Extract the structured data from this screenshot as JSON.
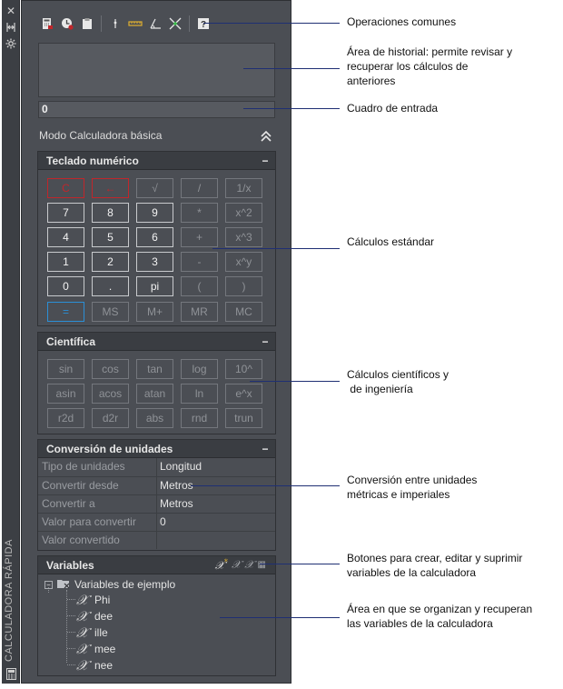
{
  "palette": {
    "panel_bg": "#4b4e54",
    "header_bg": "#3a3d42",
    "red_key": "#c0262b",
    "blue_key": "#2b8fd6",
    "callout_line": "#1f2f73"
  },
  "rail": {
    "icons": [
      "close-icon",
      "pin-icon",
      "settings-icon",
      "calculator-icon"
    ],
    "title": "CALCULADORA RÁPIDA"
  },
  "toolbar": {
    "icons": [
      "clear-icon",
      "history-clear-icon",
      "paste-icon",
      "get-point-icon",
      "distance-icon",
      "angle-icon",
      "intersection-icon",
      "help-icon"
    ]
  },
  "input": {
    "value": "0"
  },
  "mode": {
    "label": "Modo Calculadora básica"
  },
  "numpad": {
    "title": "Teclado numérico",
    "collapse": "−",
    "rows": [
      [
        "C",
        "←",
        "√",
        "/",
        "1/x"
      ],
      [
        "7",
        "8",
        "9",
        "*",
        "x^2"
      ],
      [
        "4",
        "5",
        "6",
        "+",
        "x^3"
      ],
      [
        "1",
        "2",
        "3",
        "-",
        "x^y"
      ],
      [
        "0",
        ".",
        "pi",
        "(",
        ")"
      ],
      [
        "=",
        "MS",
        "M+",
        "MR",
        "MC"
      ]
    ]
  },
  "scientific": {
    "title": "Científica",
    "collapse": "−",
    "rows": [
      [
        "sin",
        "cos",
        "tan",
        "log",
        "10^"
      ],
      [
        "asin",
        "acos",
        "atan",
        "ln",
        "e^x"
      ],
      [
        "r2d",
        "d2r",
        "abs",
        "rnd",
        "trun"
      ]
    ]
  },
  "units": {
    "title": "Conversión de unidades",
    "collapse": "−",
    "rows": [
      {
        "label": "Tipo de unidades",
        "value": "Longitud"
      },
      {
        "label": "Convertir desde",
        "value": "Metros"
      },
      {
        "label": "Convertir a",
        "value": "Metros"
      },
      {
        "label": "Valor para convertir",
        "value": "0"
      },
      {
        "label": "Valor convertido",
        "value": ""
      }
    ]
  },
  "variables": {
    "title": "Variables",
    "tool_icons": [
      "new-variable-icon",
      "edit-variable-icon",
      "delete-variable-icon",
      "calculator-icon"
    ],
    "root_toggle": "−",
    "root_label": "Variables de ejemplo",
    "items": [
      "Phi",
      "dee",
      "ille",
      "mee",
      "nee"
    ]
  },
  "callouts": [
    {
      "text": "Operaciones comunes"
    },
    {
      "text": "Área de historial: permite revisar y\nrecuperar los cálculos de\nanteriores"
    },
    {
      "text": "Cuadro de entrada"
    },
    {
      "text": "Cálculos estándar"
    },
    {
      "text": "Cálculos científicos y\n de ingeniería"
    },
    {
      "text": "Conversión entre unidades\nmétricas e imperiales"
    },
    {
      "text": "Botones para crear, editar y suprimir\nvariables de la calculadora"
    },
    {
      "text": "Área en que se organizan y recuperan\nlas variables de la calculadora"
    }
  ]
}
